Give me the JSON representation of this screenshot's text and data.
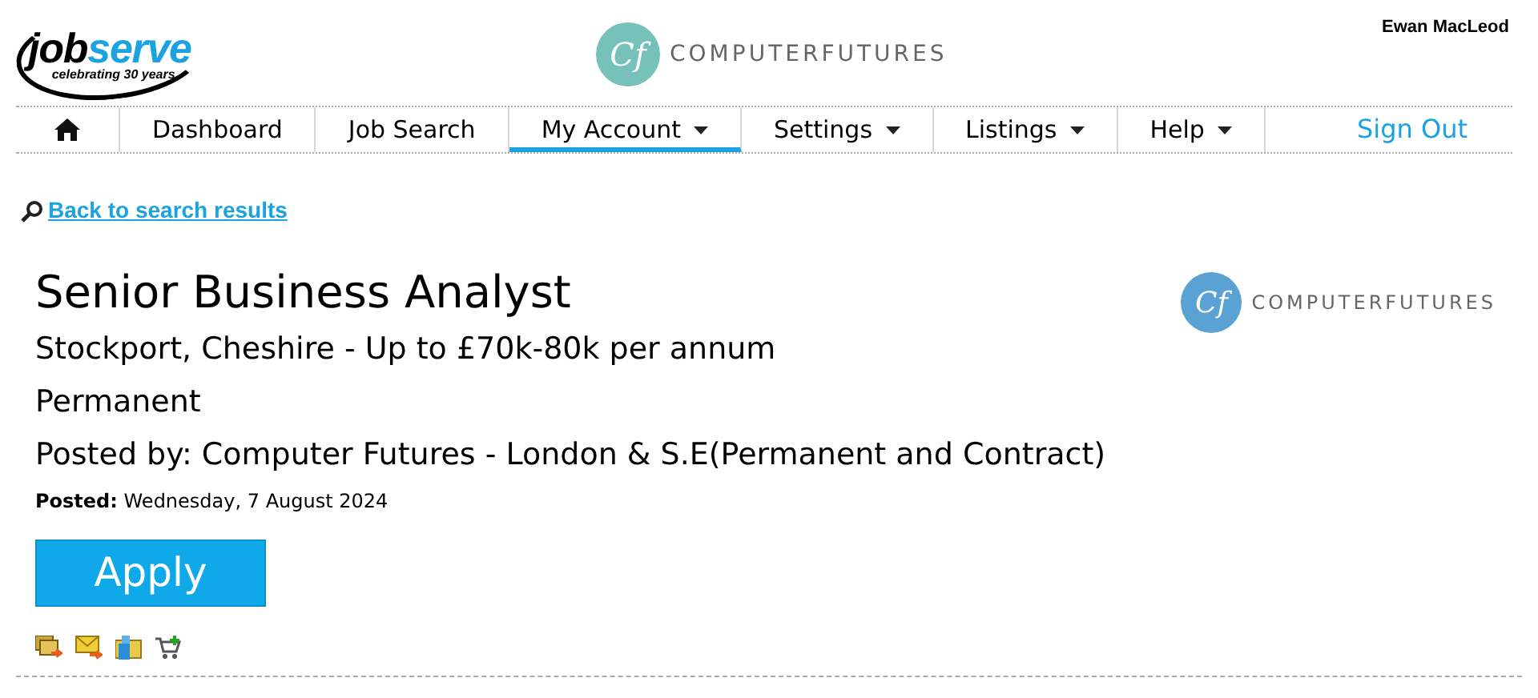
{
  "header": {
    "site_logo": {
      "name_dark": "job",
      "name_light": "serve",
      "tagline": "celebrating 30 years"
    },
    "partner_logo": {
      "monogram": "Cf",
      "name": "COMPUTERFUTURES"
    },
    "user": "Ewan MacLeod"
  },
  "nav": {
    "items": [
      {
        "kind": "home",
        "selected": false,
        "dropdown": false
      },
      {
        "kind": "link",
        "label": "Dashboard",
        "selected": false,
        "dropdown": false
      },
      {
        "kind": "link",
        "label": "Job Search",
        "selected": false,
        "dropdown": false
      },
      {
        "kind": "link",
        "label": "My Account",
        "selected": true,
        "dropdown": true
      },
      {
        "kind": "link",
        "label": "Settings",
        "selected": false,
        "dropdown": true
      },
      {
        "kind": "link",
        "label": "Listings",
        "selected": false,
        "dropdown": true
      },
      {
        "kind": "link",
        "label": "Help",
        "selected": false,
        "dropdown": true
      }
    ],
    "sign_out": "Sign Out"
  },
  "back_link": "Back to search results",
  "job": {
    "title": "Senior Business Analyst",
    "location_salary": "Stockport, Cheshire - Up to £70k-80k per annum",
    "type": "Permanent",
    "posted_by": "Posted by: Computer Futures - London & S.E(Permanent and Contract)",
    "posted": "**Posted:** Wednesday, 7 August 2024",
    "apply": "Apply",
    "company_logo": {
      "monogram": "Cf",
      "name": "COMPUTERFUTURES"
    }
  },
  "actions": [
    {
      "kind": "similar"
    },
    {
      "kind": "email"
    },
    {
      "kind": "save"
    },
    {
      "kind": "basket"
    }
  ]
}
